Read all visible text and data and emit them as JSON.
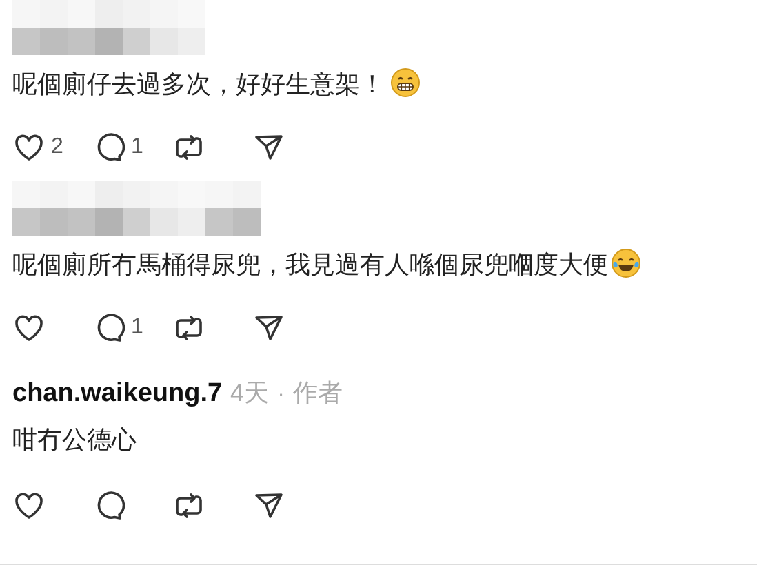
{
  "comments": [
    {
      "author": {
        "kind": "redacted"
      },
      "text": "呢個廁仔去過多次，好好生意架！",
      "emoji": {
        "kind": "grin"
      },
      "likes": "2",
      "replies": "1"
    },
    {
      "author": {
        "kind": "redacted"
      },
      "text": "呢個廁所冇馬桶得尿兜，我見過有人喺個尿兜嗰度大便",
      "emoji": {
        "kind": "tears"
      },
      "replies": "1"
    },
    {
      "author": {
        "kind": "named",
        "name": "chan.waikeung.7",
        "time": "4天",
        "separator": "·",
        "badge": "作者"
      },
      "text": "咁冇公德心"
    }
  ]
}
